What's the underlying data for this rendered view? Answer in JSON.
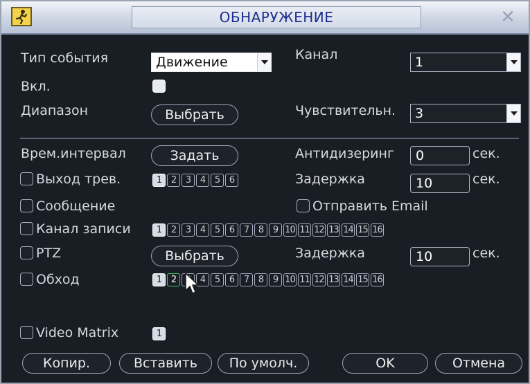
{
  "window": {
    "title": "ОБНАРУЖЕНИЕ",
    "app_icon": "running-man-icon",
    "close_glyph": "✕"
  },
  "event_type": {
    "label": "Тип события",
    "value": "Движение"
  },
  "channel": {
    "label": "Канал",
    "value": "1"
  },
  "enable": {
    "label": "Вкл.",
    "checked": true
  },
  "range": {
    "label": "Диапазон",
    "button": "Выбрать"
  },
  "sensitivity": {
    "label": "Чувствительн.",
    "value": "3"
  },
  "period": {
    "label": "Врем.интервал",
    "button": "Задать"
  },
  "anti_dither": {
    "label": "Антидизеринг",
    "value": "0",
    "unit": "сек."
  },
  "alarm_out": {
    "label": "Выход трев.",
    "checked": false,
    "channels": [
      "1",
      "2",
      "3",
      "4",
      "5",
      "6"
    ],
    "active": [
      "1"
    ]
  },
  "delay1": {
    "label": "Задержка",
    "value": "10",
    "unit": "сек."
  },
  "message": {
    "label": "Сообщение",
    "checked": false
  },
  "send_email": {
    "label": "Отправить Email",
    "checked": false
  },
  "record_channel": {
    "label": "Канал записи",
    "checked": false,
    "channels": [
      "1",
      "2",
      "3",
      "4",
      "5",
      "6",
      "7",
      "8",
      "9",
      "10",
      "11",
      "12",
      "13",
      "14",
      "15",
      "16"
    ],
    "active": [
      "1"
    ]
  },
  "ptz": {
    "label": "PTZ",
    "checked": false,
    "button": "Выбрать"
  },
  "delay2": {
    "label": "Задержка",
    "value": "10",
    "unit": "сек."
  },
  "tour": {
    "label": "Обход",
    "checked": false,
    "channels": [
      "1",
      "2",
      "3",
      "4",
      "5",
      "6",
      "7",
      "8",
      "9",
      "10",
      "11",
      "12",
      "13",
      "14",
      "15",
      "16"
    ],
    "active": [
      "1"
    ],
    "highlighted": "2"
  },
  "video_matrix": {
    "label": "Video Matrix",
    "checked": false,
    "channels": [
      "1"
    ],
    "active": [
      "1"
    ]
  },
  "buttons": {
    "copy": "Копир.",
    "paste": "Вставить",
    "default": "По умолч.",
    "ok": "OK",
    "cancel": "Отмена"
  },
  "colors": {
    "background": "#191d24",
    "text": "#d6d9df",
    "title_text": "#1a2c8c",
    "highlight": "#3ccf5e"
  }
}
